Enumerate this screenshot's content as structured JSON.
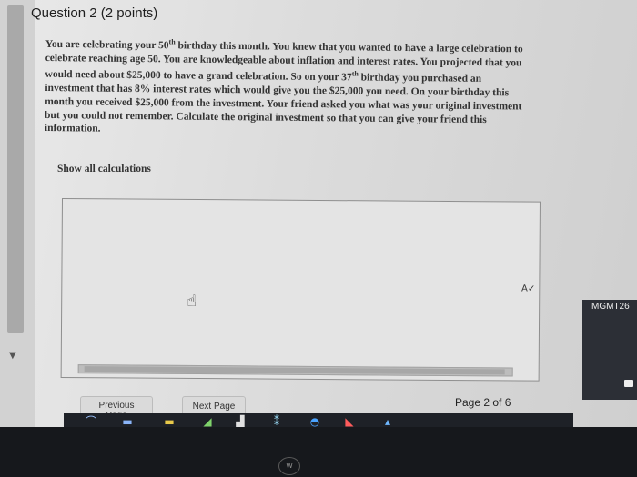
{
  "question": {
    "title": "Question 2 (2 points)",
    "body_lines": [
      [
        "You are celebrating your 50",
        "th",
        " birthday this month. You knew that you wanted to have a large celebration to"
      ],
      [
        "celebrate reaching age 50. You are knowledgeable about inflation and interest rates. You projected that you",
        "",
        ""
      ],
      [
        "would need about $25,000 to have a grand celebration. So on your 37",
        "th",
        " birthday you purchased an"
      ],
      [
        "investment that has 8% interest rates which would give you the $25,000 you need. On your birthday this",
        "",
        ""
      ],
      [
        "month you received $25,000 from the investment. Your friend asked you what was your original investment",
        "",
        ""
      ],
      [
        "but you could not remember. Calculate the original investment so that you can give your friend this",
        "",
        ""
      ],
      [
        "information.",
        "",
        ""
      ]
    ],
    "instruction": "Show all calculations"
  },
  "answer": {
    "value": ""
  },
  "nav": {
    "previous_label": "Previous Page",
    "next_label": "Next Page",
    "page_indicator": "Page 2 of 6"
  },
  "side_panel": {
    "label": "MGMT26"
  },
  "icons": {
    "cursor": "hand-pointer-icon",
    "spellcheck": "spellcheck-icon",
    "logo": "w"
  }
}
